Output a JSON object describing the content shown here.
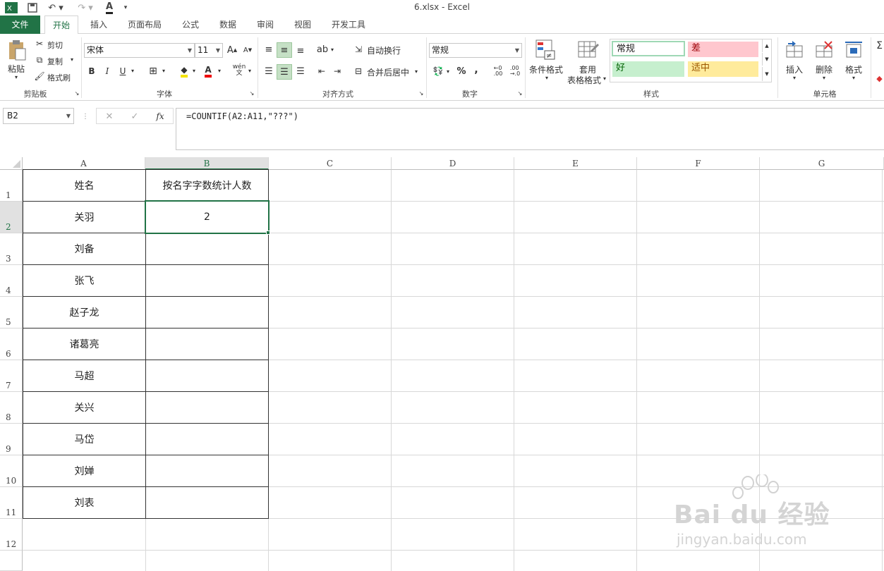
{
  "window": {
    "title": "6.xlsx - Excel"
  },
  "tabs": [
    {
      "label": "文件"
    },
    {
      "label": "开始"
    },
    {
      "label": "插入"
    },
    {
      "label": "页面布局"
    },
    {
      "label": "公式"
    },
    {
      "label": "数据"
    },
    {
      "label": "审阅"
    },
    {
      "label": "视图"
    },
    {
      "label": "开发工具"
    }
  ],
  "ribbon": {
    "clipboard": {
      "paste": "粘贴",
      "cut": "剪切",
      "copy": "复制",
      "format_painter": "格式刷",
      "label": "剪贴板"
    },
    "font": {
      "name": "宋体",
      "size": "11",
      "label": "字体",
      "bold": "B",
      "italic": "I",
      "underline": "U",
      "grow": "A",
      "shrink": "A",
      "color": "A",
      "phonetic": "wén"
    },
    "alignment": {
      "wrap": "自动换行",
      "merge": "合并后居中",
      "label": "对齐方式"
    },
    "number": {
      "format": "常规",
      "percent": "%",
      "comma": ",",
      "label": "数字"
    },
    "styles": {
      "conditional": "条件格式",
      "table_line1": "套用",
      "table_line2": "表格格式",
      "normal": "常规",
      "bad": "差",
      "good": "好",
      "neutral": "适中",
      "label": "样式"
    },
    "cells": {
      "insert": "插入",
      "delete": "删除",
      "format": "格式",
      "label": "单元格"
    }
  },
  "formula_bar": {
    "name_box": "B2",
    "formula": "=COUNTIF(A2:A11,\"???\")",
    "fx": "fx"
  },
  "sheet": {
    "columns": [
      "A",
      "B",
      "C",
      "D",
      "E",
      "F",
      "G"
    ],
    "rows": [
      "1",
      "2",
      "3",
      "4",
      "5",
      "6",
      "7",
      "8",
      "9",
      "10",
      "11",
      "12"
    ],
    "header_a": "姓名",
    "header_b": "按名字字数统计人数",
    "names": [
      "关羽",
      "刘备",
      "张飞",
      "赵子龙",
      "诸葛亮",
      "马超",
      "关兴",
      "马岱",
      "刘婵",
      "刘表"
    ],
    "result": "2"
  },
  "watermark": {
    "brand": "Bai du 经验",
    "url": "jingyan.baidu.com"
  },
  "colors": {
    "accent": "#217346",
    "bad_bg": "#ffc7ce",
    "bad_fg": "#9c0006",
    "good_bg": "#c6efce",
    "good_fg": "#006100",
    "neutral_bg": "#ffeb9c",
    "neutral_fg": "#9c5700"
  }
}
